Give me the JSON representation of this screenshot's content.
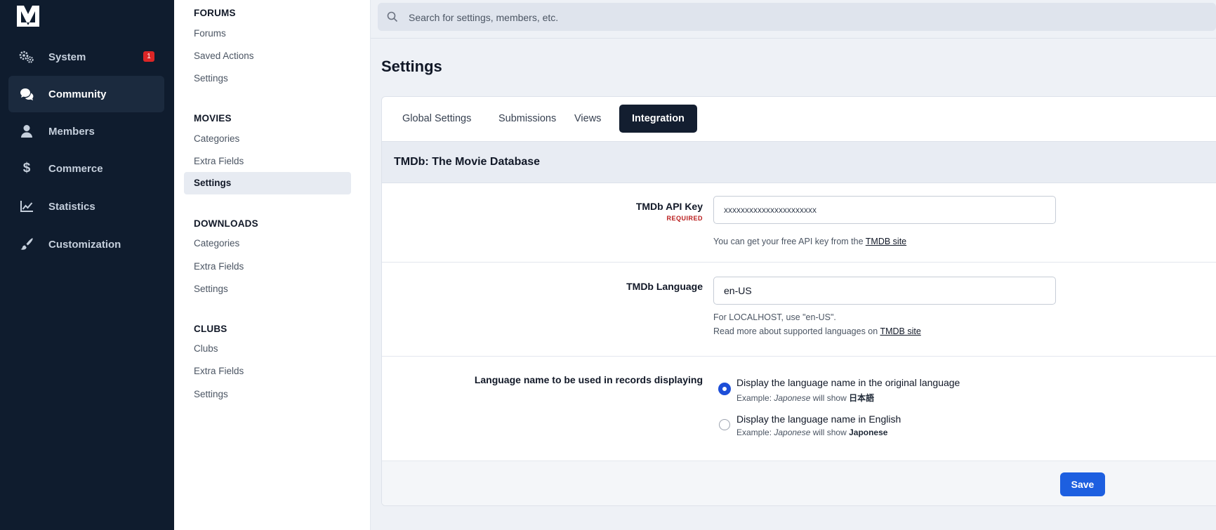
{
  "nav": {
    "items": [
      {
        "label": "System",
        "icon": "gears-icon",
        "badge": "1"
      },
      {
        "label": "Community",
        "icon": "chat-bubbles-icon"
      },
      {
        "label": "Members",
        "icon": "user-icon"
      },
      {
        "label": "Commerce",
        "icon": "dollar-icon"
      },
      {
        "label": "Statistics",
        "icon": "line-chart-icon"
      },
      {
        "label": "Customization",
        "icon": "brush-icon"
      }
    ]
  },
  "subnav": {
    "groups": [
      {
        "title": "FORUMS",
        "items": [
          "Forums",
          "Saved Actions",
          "Settings"
        ]
      },
      {
        "title": "MOVIES",
        "items": [
          "Categories",
          "Extra Fields",
          "Settings"
        ]
      },
      {
        "title": "DOWNLOADS",
        "items": [
          "Categories",
          "Extra Fields",
          "Settings"
        ]
      },
      {
        "title": "CLUBS",
        "items": [
          "Clubs",
          "Extra Fields",
          "Settings"
        ]
      }
    ]
  },
  "search": {
    "placeholder": "Search for settings, members, etc."
  },
  "page": {
    "title": "Settings"
  },
  "tabs": [
    "Global Settings",
    "Submissions",
    "Views",
    "Integration"
  ],
  "section": {
    "title": "TMDb: The Movie Database"
  },
  "form": {
    "api_key": {
      "label": "TMDb API Key",
      "required": "REQUIRED",
      "value": "xxxxxxxxxxxxxxxxxxxxxx",
      "desc_text": "You can get your free API key from the ",
      "desc_link": "TMDB site"
    },
    "language": {
      "label": "TMDb Language",
      "value": "en-US",
      "desc_line1": "For LOCALHOST, use \"en-US\".",
      "desc_line2_text": "Read more about supported languages on ",
      "desc_link": "TMDB site"
    },
    "display": {
      "label": "Language name to be used in records displaying",
      "options": [
        {
          "label": "Display the language name in the original language",
          "example_prefix": "Example: ",
          "example_italic": "Japonese",
          "example_mid": " will show ",
          "example_bold": "日本語",
          "selected": true
        },
        {
          "label": "Display the language name in English",
          "example_prefix": "Example: ",
          "example_italic": "Japonese",
          "example_mid": " will show ",
          "example_bold": "Japonese",
          "selected": false
        }
      ]
    }
  },
  "footer": {
    "save_label": "Save"
  },
  "colors": {
    "nav_bg": "#0f1c2e",
    "accent": "#1d5fe0",
    "badge": "#dc2626",
    "active_tab": "#131e30"
  }
}
